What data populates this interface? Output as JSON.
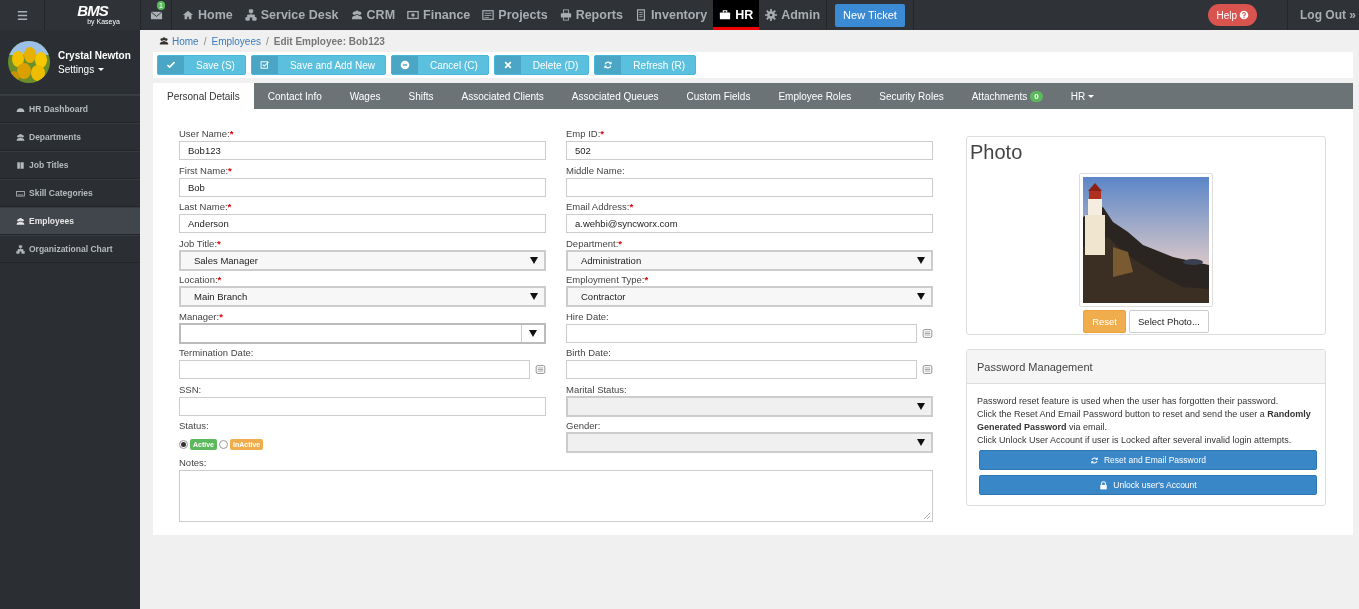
{
  "topbar": {
    "logo": "BMS",
    "logo_sub": "by Kaseya",
    "mail_badge": "1",
    "nav": [
      {
        "label": "Home",
        "selected": false
      },
      {
        "label": "Service Desk",
        "selected": false
      },
      {
        "label": "CRM",
        "selected": false
      },
      {
        "label": "Finance",
        "selected": false
      },
      {
        "label": "Projects",
        "selected": false
      },
      {
        "label": "Reports",
        "selected": false
      },
      {
        "label": "Inventory",
        "selected": false
      },
      {
        "label": "HR",
        "selected": true
      },
      {
        "label": "Admin",
        "selected": false
      }
    ],
    "new_ticket": "New Ticket",
    "help": "Help",
    "logout": "Log Out »"
  },
  "sidebar": {
    "user": {
      "name": "Crystal Newton",
      "settings": "Settings"
    },
    "items": [
      {
        "label": "HR Dashboard",
        "selected": false
      },
      {
        "label": "Departments",
        "selected": false
      },
      {
        "label": "Job Titles",
        "selected": false
      },
      {
        "label": "Skill Categories",
        "selected": false
      },
      {
        "label": "Employees",
        "selected": true
      },
      {
        "label": "Organizational Chart",
        "selected": false
      }
    ]
  },
  "breadcrumb": {
    "separator": "/",
    "items": [
      {
        "label": "Home",
        "link": true
      },
      {
        "label": "Employees",
        "link": true
      },
      {
        "label": "Edit Employee: Bob123",
        "link": false
      }
    ]
  },
  "toolbar": [
    {
      "label": "Save (S)"
    },
    {
      "label": "Save and Add New"
    },
    {
      "label": "Cancel (C)"
    },
    {
      "label": "Delete (D)"
    },
    {
      "label": "Refresh (R)"
    }
  ],
  "tabs": [
    {
      "label": "Personal Details",
      "selected": true
    },
    {
      "label": "Contact Info",
      "selected": false
    },
    {
      "label": "Wages",
      "selected": false
    },
    {
      "label": "Shifts",
      "selected": false
    },
    {
      "label": "Associated Clients",
      "selected": false
    },
    {
      "label": "Associated Queues",
      "selected": false
    },
    {
      "label": "Custom Fields",
      "selected": false
    },
    {
      "label": "Employee Roles",
      "selected": false
    },
    {
      "label": "Security Roles",
      "selected": false
    },
    {
      "label": "Attachments",
      "selected": false,
      "badge": "0"
    },
    {
      "label": "HR",
      "selected": false,
      "dropdown": true
    }
  ],
  "form": {
    "fields": [
      {
        "kind": "text",
        "label": "User Name:",
        "marker": "*",
        "value": "Bob123"
      },
      {
        "kind": "text",
        "label": "Emp ID:",
        "marker": "*",
        "value": "502"
      },
      {
        "kind": "text",
        "label": "First Name:",
        "marker": "*",
        "value": "Bob"
      },
      {
        "kind": "text",
        "label": "Middle Name:"
      },
      {
        "kind": "text",
        "label": "Last Name:",
        "marker": "*",
        "value": "Anderson"
      },
      {
        "kind": "text",
        "label": "Email Address:",
        "marker": "*",
        "value": "a.wehbi@syncworx.com"
      },
      {
        "kind": "select",
        "label": "Job Title:",
        "marker": "*",
        "value": "Sales Manager"
      },
      {
        "kind": "select",
        "label": "Department:",
        "marker": "*",
        "value": "Administration"
      },
      {
        "kind": "select",
        "label": "Location:",
        "marker": "*",
        "value": "Main Branch"
      },
      {
        "kind": "select",
        "label": "Employment Type:",
        "marker": "*",
        "value": "Contractor"
      },
      {
        "kind": "combo",
        "label": "Manager:",
        "marker": "*"
      },
      {
        "kind": "date",
        "label": "Hire Date:"
      },
      {
        "kind": "date",
        "label": "Termination Date:"
      },
      {
        "kind": "date",
        "label": "Birth Date:"
      },
      {
        "kind": "text",
        "label": "SSN:"
      },
      {
        "kind": "select",
        "label": "Marital Status:",
        "disabled": true
      },
      {
        "kind": "radio",
        "label": "Status:",
        "options": [
          {
            "label": "Active",
            "selected": true,
            "color": "#5cb85c"
          },
          {
            "label": "InActive",
            "selected": false,
            "color": "#f0ad4e"
          }
        ]
      },
      {
        "kind": "select",
        "label": "Gender:",
        "disabled": true
      },
      {
        "kind": "textarea",
        "label": "Notes:"
      }
    ]
  },
  "photo": {
    "title": "Photo",
    "buttons": [
      {
        "label": "Reset",
        "kind": "warning"
      },
      {
        "label": "Select Photo...",
        "kind": "default"
      }
    ]
  },
  "password": {
    "title": "Password Management",
    "paragraphs": [
      "Password reset feature is used when the user has forgotten their password.",
      "Click the Reset And Email Password button to reset and send the user a **Randomly Generated Password** via email.",
      "Click Unlock User Account if user is Locked after several invalid login attempts."
    ],
    "buttons": [
      {
        "label": "Reset and Email Password"
      },
      {
        "label": "Unlock user's Account"
      }
    ]
  }
}
